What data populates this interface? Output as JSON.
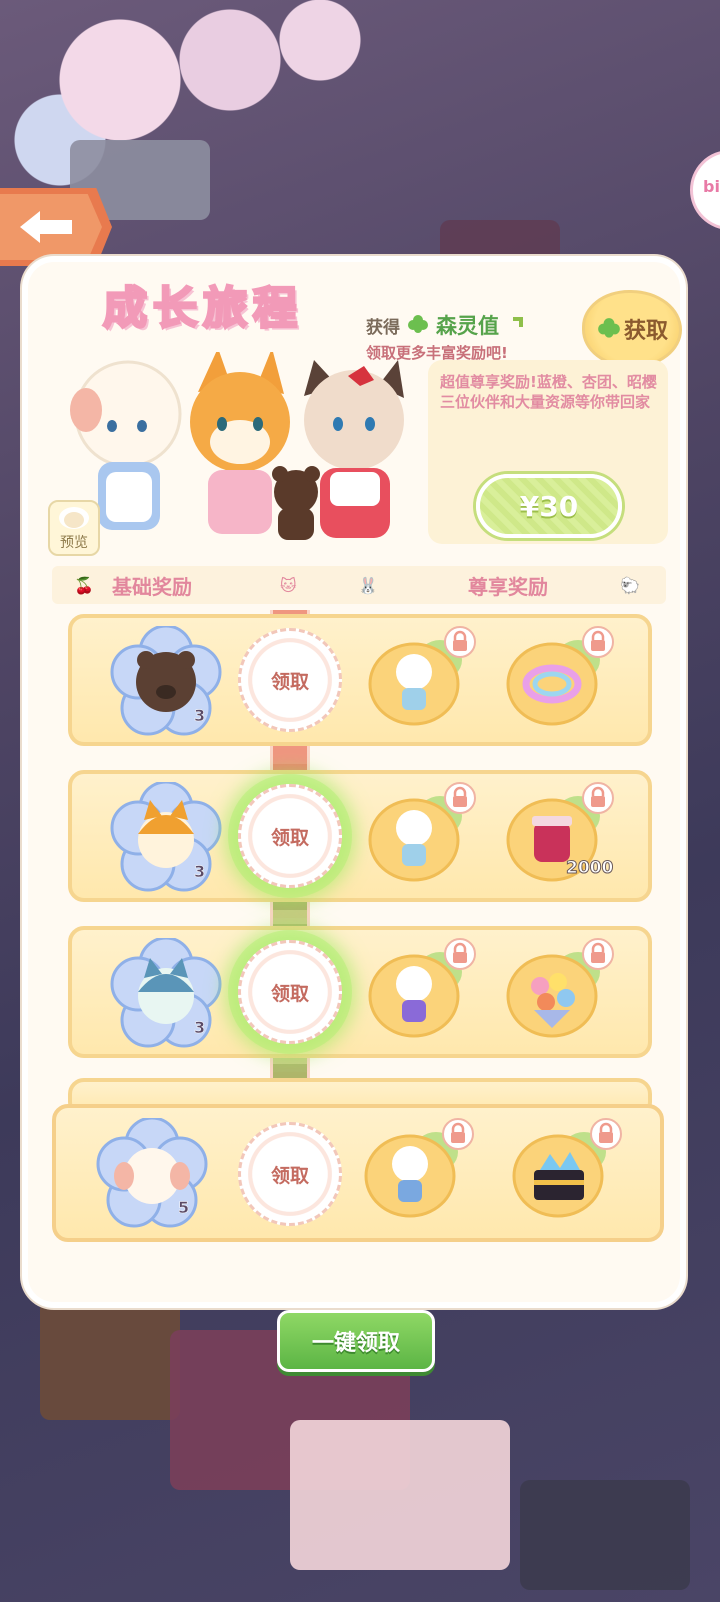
{
  "header": {
    "logo_text": "成长旅程",
    "earn_prefix": "获得",
    "earn_value_name": "森灵值",
    "earn_tip": "领取更多丰富奖励吧!",
    "get_button": "获取",
    "preview_label": "预览",
    "description": "超值尊享奖励!蓝橙、杏团、昭樱三位伙伴和大量资源等你带回家",
    "price": "¥30"
  },
  "side_bubble": "bi",
  "tiers": {
    "basic": "基础奖励",
    "premium": "尊享奖励"
  },
  "rows": [
    {
      "basic_icon": "bear-head-icon",
      "basic_qty": "3",
      "claim": "领取",
      "premium_1": "sheep-doll-icon",
      "premium_2": "rainbow-ring-icon",
      "premium_2_count": ""
    },
    {
      "basic_icon": "shiba-head-icon",
      "basic_qty": "3",
      "claim": "领取",
      "premium_1": "sheep-doll-icon",
      "premium_2": "jam-jar-icon",
      "premium_2_count": "2000"
    },
    {
      "basic_icon": "husky-head-icon",
      "basic_qty": "3",
      "claim": "领取",
      "premium_1": "sheep-doll-purple-icon",
      "premium_2": "flower-bouquet-icon",
      "premium_2_count": ""
    },
    {
      "basic_icon": "sheep-head-icon",
      "basic_qty": "5",
      "claim": "领取",
      "premium_1": "sheep-doll-blue-icon",
      "premium_2": "gem-chest-icon",
      "premium_2_count": ""
    }
  ],
  "collect_all": "一键领取",
  "colors": {
    "panel": "#fffaf2",
    "row_bg": "#ffe8ad",
    "accent_pink": "#e2879d",
    "green_button": "#5cb545"
  }
}
